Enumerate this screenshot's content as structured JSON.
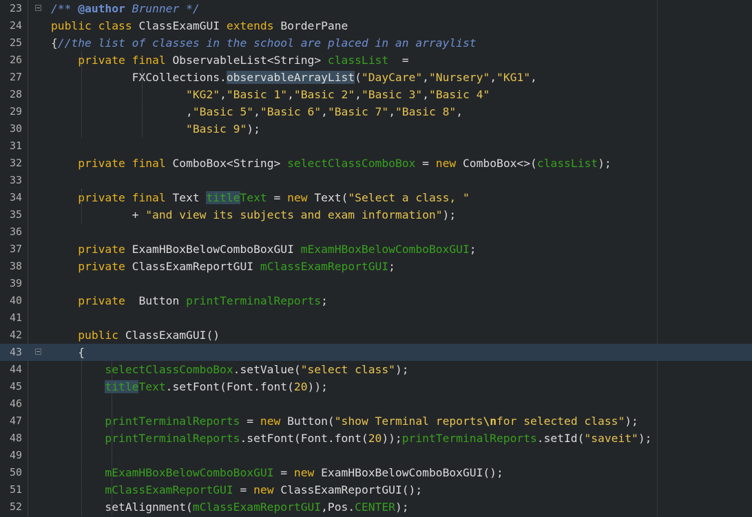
{
  "editor": {
    "lines": [
      {
        "n": "23",
        "fold": true,
        "current": false,
        "tokens": [
          {
            "t": "/** ",
            "c": "cmt"
          },
          {
            "t": "@author",
            "c": "cmt-b"
          },
          {
            "t": " Brunner */",
            "c": "cmt"
          }
        ]
      },
      {
        "n": "24",
        "fold": false,
        "current": false,
        "tokens": [
          {
            "t": "public ",
            "c": "kw"
          },
          {
            "t": "class ",
            "c": "kw"
          },
          {
            "t": "ClassExamGUI ",
            "c": "typ"
          },
          {
            "t": "extends ",
            "c": "kw"
          },
          {
            "t": "BorderPane",
            "c": "typ"
          }
        ]
      },
      {
        "n": "25",
        "fold": false,
        "current": false,
        "tokens": [
          {
            "t": "{",
            "c": "pun"
          },
          {
            "t": "//the list of classes in the school are placed in an arraylist",
            "c": "cmt"
          }
        ]
      },
      {
        "n": "26",
        "fold": false,
        "current": false,
        "tokens": [
          {
            "t": "    private ",
            "c": "kw"
          },
          {
            "t": "final ",
            "c": "kw"
          },
          {
            "t": "ObservableList<String> ",
            "c": "typ"
          },
          {
            "t": "classList",
            "c": "fld"
          },
          {
            "t": "  =",
            "c": "pun"
          }
        ]
      },
      {
        "n": "27",
        "fold": false,
        "current": false,
        "tokens": [
          {
            "t": "            FXCollections.",
            "c": "typ"
          },
          {
            "t": "observableArrayList",
            "c": "typ hl"
          },
          {
            "t": "(",
            "c": "pun"
          },
          {
            "t": "\"DayCare\"",
            "c": "str"
          },
          {
            "t": ",",
            "c": "pun"
          },
          {
            "t": "\"Nursery\"",
            "c": "str"
          },
          {
            "t": ",",
            "c": "pun"
          },
          {
            "t": "\"KG1\"",
            "c": "str"
          },
          {
            "t": ",",
            "c": "pun"
          }
        ]
      },
      {
        "n": "28",
        "fold": false,
        "current": false,
        "tokens": [
          {
            "t": "                    ",
            "c": "pun"
          },
          {
            "t": "\"KG2\"",
            "c": "str"
          },
          {
            "t": ",",
            "c": "pun"
          },
          {
            "t": "\"Basic 1\"",
            "c": "str"
          },
          {
            "t": ",",
            "c": "pun"
          },
          {
            "t": "\"Basic 2\"",
            "c": "str"
          },
          {
            "t": ",",
            "c": "pun"
          },
          {
            "t": "\"Basic 3\"",
            "c": "str"
          },
          {
            "t": ",",
            "c": "pun"
          },
          {
            "t": "\"Basic 4\"",
            "c": "str"
          }
        ]
      },
      {
        "n": "29",
        "fold": false,
        "current": false,
        "tokens": [
          {
            "t": "                    ,",
            "c": "pun"
          },
          {
            "t": "\"Basic 5\"",
            "c": "str"
          },
          {
            "t": ",",
            "c": "pun"
          },
          {
            "t": "\"Basic 6\"",
            "c": "str"
          },
          {
            "t": ",",
            "c": "pun"
          },
          {
            "t": "\"Basic 7\"",
            "c": "str"
          },
          {
            "t": ",",
            "c": "pun"
          },
          {
            "t": "\"Basic 8\"",
            "c": "str"
          },
          {
            "t": ",",
            "c": "pun"
          }
        ]
      },
      {
        "n": "30",
        "fold": false,
        "current": false,
        "tokens": [
          {
            "t": "                    ",
            "c": "pun"
          },
          {
            "t": "\"Basic 9\"",
            "c": "str"
          },
          {
            "t": ");",
            "c": "pun"
          }
        ]
      },
      {
        "n": "31",
        "fold": false,
        "current": false,
        "tokens": []
      },
      {
        "n": "32",
        "fold": false,
        "current": false,
        "tokens": [
          {
            "t": "    private ",
            "c": "kw"
          },
          {
            "t": "final ",
            "c": "kw"
          },
          {
            "t": "ComboBox<String> ",
            "c": "typ"
          },
          {
            "t": "selectClassComboBox",
            "c": "fld"
          },
          {
            "t": " = ",
            "c": "pun"
          },
          {
            "t": "new ",
            "c": "kw"
          },
          {
            "t": "ComboBox<>(",
            "c": "typ"
          },
          {
            "t": "classList",
            "c": "fld"
          },
          {
            "t": ");",
            "c": "pun"
          }
        ]
      },
      {
        "n": "33",
        "fold": false,
        "current": false,
        "tokens": []
      },
      {
        "n": "34",
        "fold": false,
        "current": false,
        "tokens": [
          {
            "t": "    private ",
            "c": "kw"
          },
          {
            "t": "final ",
            "c": "kw"
          },
          {
            "t": "Text ",
            "c": "typ"
          },
          {
            "t": "title",
            "c": "fld hl2"
          },
          {
            "t": "Text",
            "c": "fld"
          },
          {
            "t": " = ",
            "c": "pun"
          },
          {
            "t": "new ",
            "c": "kw"
          },
          {
            "t": "Text(",
            "c": "typ"
          },
          {
            "t": "\"Select a class, \"",
            "c": "str"
          }
        ]
      },
      {
        "n": "35",
        "fold": false,
        "current": false,
        "tokens": [
          {
            "t": "            + ",
            "c": "pun"
          },
          {
            "t": "\"and view its subjects and exam information\"",
            "c": "str"
          },
          {
            "t": ");",
            "c": "pun"
          }
        ]
      },
      {
        "n": "36",
        "fold": false,
        "current": false,
        "tokens": []
      },
      {
        "n": "37",
        "fold": false,
        "current": false,
        "tokens": [
          {
            "t": "    private ",
            "c": "kw"
          },
          {
            "t": "ExamHBoxBelowComboBoxGUI ",
            "c": "typ"
          },
          {
            "t": "mExamHBoxBelowComboBoxGUI",
            "c": "fld"
          },
          {
            "t": ";",
            "c": "pun"
          }
        ]
      },
      {
        "n": "38",
        "fold": false,
        "current": false,
        "tokens": [
          {
            "t": "    private ",
            "c": "kw"
          },
          {
            "t": "ClassExamReportGUI ",
            "c": "typ"
          },
          {
            "t": "mClassExamReportGUI",
            "c": "fld"
          },
          {
            "t": ";",
            "c": "pun"
          }
        ]
      },
      {
        "n": "39",
        "fold": false,
        "current": false,
        "tokens": []
      },
      {
        "n": "40",
        "fold": false,
        "current": false,
        "tokens": [
          {
            "t": "    private ",
            "c": "kw"
          },
          {
            "t": " Button ",
            "c": "typ"
          },
          {
            "t": "printTerminalReports",
            "c": "fld"
          },
          {
            "t": ";",
            "c": "pun"
          }
        ]
      },
      {
        "n": "41",
        "fold": false,
        "current": false,
        "tokens": []
      },
      {
        "n": "42",
        "fold": false,
        "current": false,
        "tokens": [
          {
            "t": "    public ",
            "c": "kw"
          },
          {
            "t": "ClassExamGUI()",
            "c": "typ"
          }
        ]
      },
      {
        "n": "43",
        "fold": true,
        "current": true,
        "tokens": [
          {
            "t": "    {",
            "c": "pun"
          }
        ]
      },
      {
        "n": "44",
        "fold": false,
        "current": false,
        "tokens": [
          {
            "t": "        ",
            "c": "pun"
          },
          {
            "t": "selectClassComboBox",
            "c": "fld"
          },
          {
            "t": ".setValue(",
            "c": "typ"
          },
          {
            "t": "\"select class\"",
            "c": "str"
          },
          {
            "t": ");",
            "c": "pun"
          }
        ]
      },
      {
        "n": "45",
        "fold": false,
        "current": false,
        "tokens": [
          {
            "t": "        ",
            "c": "pun"
          },
          {
            "t": "title",
            "c": "fld hl2"
          },
          {
            "t": "Text",
            "c": "fld"
          },
          {
            "t": ".setFont(Font.font(",
            "c": "typ"
          },
          {
            "t": "20",
            "c": "num"
          },
          {
            "t": "));",
            "c": "pun"
          }
        ]
      },
      {
        "n": "46",
        "fold": false,
        "current": false,
        "tokens": []
      },
      {
        "n": "47",
        "fold": false,
        "current": false,
        "tokens": [
          {
            "t": "        ",
            "c": "pun"
          },
          {
            "t": "printTerminalReports",
            "c": "fld"
          },
          {
            "t": " = ",
            "c": "pun"
          },
          {
            "t": "new ",
            "c": "kw"
          },
          {
            "t": "Button(",
            "c": "typ"
          },
          {
            "t": "\"show Terminal reports",
            "c": "str"
          },
          {
            "t": "\\n",
            "c": "esc"
          },
          {
            "t": "for selected class\"",
            "c": "str"
          },
          {
            "t": ");",
            "c": "pun"
          }
        ]
      },
      {
        "n": "48",
        "fold": false,
        "current": false,
        "tokens": [
          {
            "t": "        ",
            "c": "pun"
          },
          {
            "t": "printTerminalReports",
            "c": "fld"
          },
          {
            "t": ".setFont(Font.font(",
            "c": "typ"
          },
          {
            "t": "20",
            "c": "num"
          },
          {
            "t": "));",
            "c": "pun"
          },
          {
            "t": "printTerminalReports",
            "c": "fld"
          },
          {
            "t": ".setId(",
            "c": "typ"
          },
          {
            "t": "\"saveit\"",
            "c": "str"
          },
          {
            "t": ");",
            "c": "pun"
          }
        ]
      },
      {
        "n": "49",
        "fold": false,
        "current": false,
        "tokens": []
      },
      {
        "n": "50",
        "fold": false,
        "current": false,
        "tokens": [
          {
            "t": "        ",
            "c": "pun"
          },
          {
            "t": "mExamHBoxBelowComboBoxGUI",
            "c": "fld"
          },
          {
            "t": " = ",
            "c": "pun"
          },
          {
            "t": "new ",
            "c": "kw"
          },
          {
            "t": "ExamHBoxBelowComboBoxGUI();",
            "c": "typ"
          }
        ]
      },
      {
        "n": "51",
        "fold": false,
        "current": false,
        "tokens": [
          {
            "t": "        ",
            "c": "pun"
          },
          {
            "t": "mClassExamReportGUI",
            "c": "fld"
          },
          {
            "t": " = ",
            "c": "pun"
          },
          {
            "t": "new ",
            "c": "kw"
          },
          {
            "t": "ClassExamReportGUI();",
            "c": "typ"
          }
        ]
      },
      {
        "n": "52",
        "fold": false,
        "current": false,
        "tokens": [
          {
            "t": "        setAlignment(",
            "c": "typ"
          },
          {
            "t": "mClassExamReportGUI",
            "c": "fld"
          },
          {
            "t": ",Pos.",
            "c": "typ"
          },
          {
            "t": "CENTER",
            "c": "fld"
          },
          {
            "t": ");",
            "c": "pun"
          }
        ]
      }
    ]
  },
  "colors": {
    "background": "#232629",
    "keyword": "#e6b422",
    "field": "#38a01f",
    "string": "#e6c350",
    "comment": "#6d8fd1",
    "current_line": "#2c3c4c"
  }
}
